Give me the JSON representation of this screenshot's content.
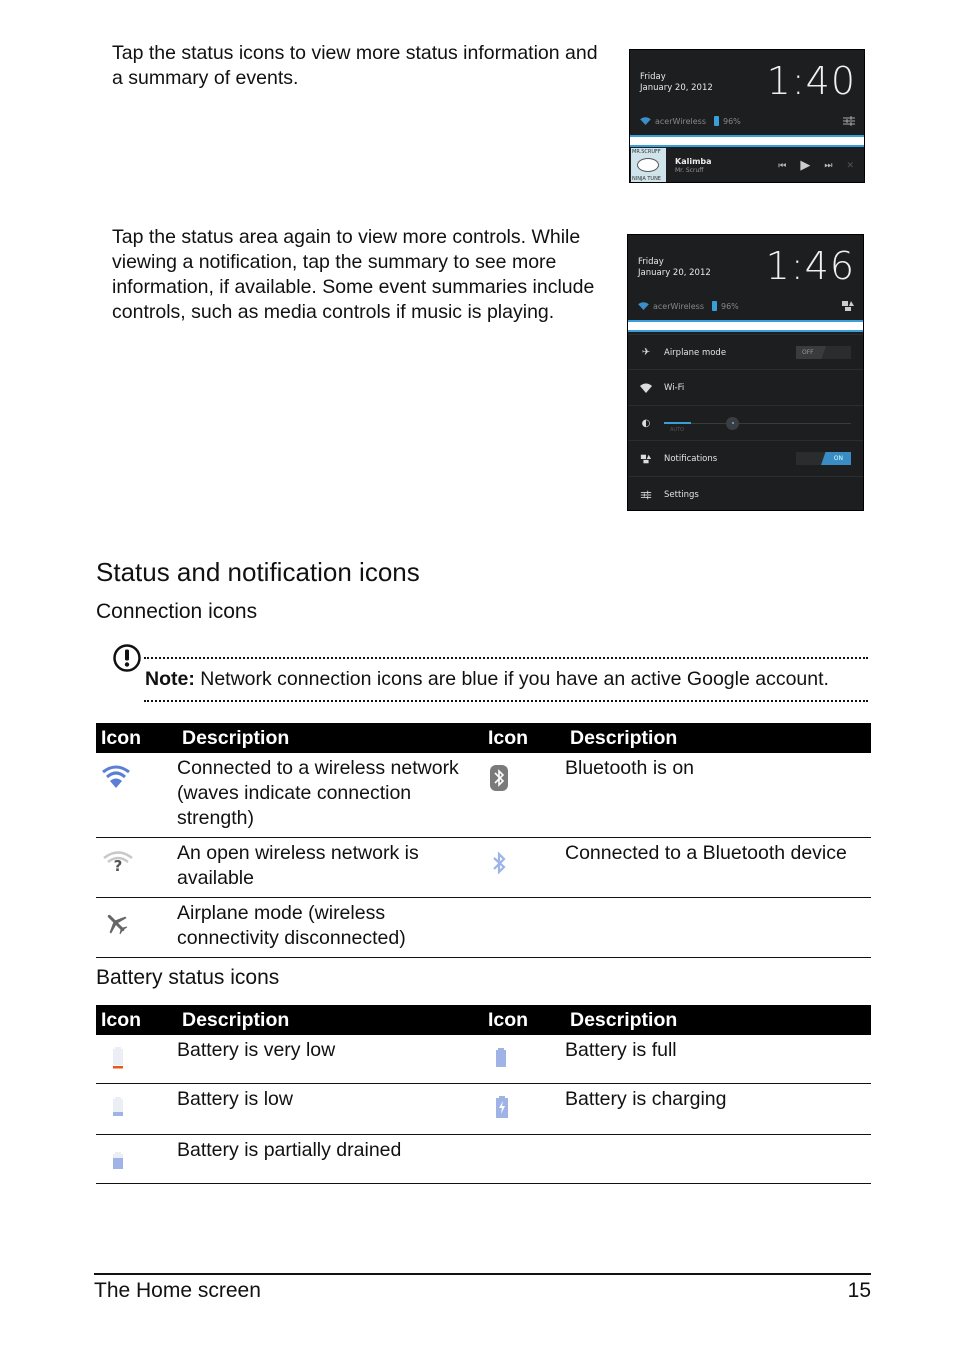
{
  "intro": {
    "para1": "Tap the status icons to view more status information and a summary of events.",
    "para2": "Tap the status area again to view more controls. While viewing a notification, tap the summary to see more information, if available. Some event summaries include controls, such as media controls if music is playing."
  },
  "screenshot1": {
    "day": "Friday",
    "date": "January 20, 2012",
    "time": "1:40",
    "network": "acerWireless",
    "battery": "96%",
    "media": {
      "album_top": "MR.SCRUFF",
      "album_bottom": "NINJA TUNE",
      "title": "Kalimba",
      "artist": "Mr. Scruff",
      "prev_icon": "⏮",
      "play_icon": "▶",
      "next_icon": "⏭",
      "close_icon": "✕"
    }
  },
  "screenshot2": {
    "day": "Friday",
    "date": "January 20, 2012",
    "time": "1:46",
    "network": "acerWireless",
    "battery": "96%",
    "quick_settings": [
      {
        "label": "Airplane mode",
        "icon": "airplane-icon",
        "toggle": "OFF"
      },
      {
        "label": "Wi-Fi",
        "icon": "wifi-icon"
      },
      {
        "label": "",
        "icon": "brightness-icon",
        "slider_label": "AUTO"
      },
      {
        "label": "Notifications",
        "icon": "notifications-icon",
        "toggle": "ON"
      },
      {
        "label": "Settings",
        "icon": "settings-icon"
      }
    ]
  },
  "section_title": "Status and notification icons",
  "connection": {
    "heading": "Connection icons",
    "note_label": "Note:",
    "note_text": " Network connection icons are blue if you have an active Google account.",
    "headers": [
      "Icon",
      "Description",
      "Icon",
      "Description"
    ],
    "rows": [
      {
        "left_icon": "wifi-connected-icon",
        "left_desc": "Connected to a wireless network (waves indicate connection strength)",
        "right_icon": "bluetooth-on-icon",
        "right_desc": "Bluetooth is on"
      },
      {
        "left_icon": "wifi-open-network-icon",
        "left_desc": "An open wireless network is available",
        "right_icon": "bluetooth-connected-icon",
        "right_desc": "Connected to a Bluetooth device"
      },
      {
        "left_icon": "airplane-mode-icon",
        "left_desc": "Airplane mode (wireless connectivity disconnected)",
        "right_icon": "",
        "right_desc": ""
      }
    ]
  },
  "battery": {
    "heading": "Battery status icons",
    "headers": [
      "Icon",
      "Description",
      "Icon",
      "Description"
    ],
    "rows": [
      {
        "left_icon": "battery-very-low-icon",
        "left_desc": "Battery is very low",
        "right_icon": "battery-full-icon",
        "right_desc": "Battery is full"
      },
      {
        "left_icon": "battery-low-icon",
        "left_desc": "Battery is low",
        "right_icon": "battery-charging-icon",
        "right_desc": "Battery is charging"
      },
      {
        "left_icon": "battery-partially-drained-icon",
        "left_desc": "Battery is partially drained",
        "right_icon": "",
        "right_desc": ""
      }
    ]
  },
  "colors": {
    "icon_blue": "#6f8fd6",
    "android_accent": "#3a9fd8",
    "battery_warning": "#e8581c"
  },
  "footer": {
    "chapter": "The Home screen",
    "page_number": "15"
  }
}
